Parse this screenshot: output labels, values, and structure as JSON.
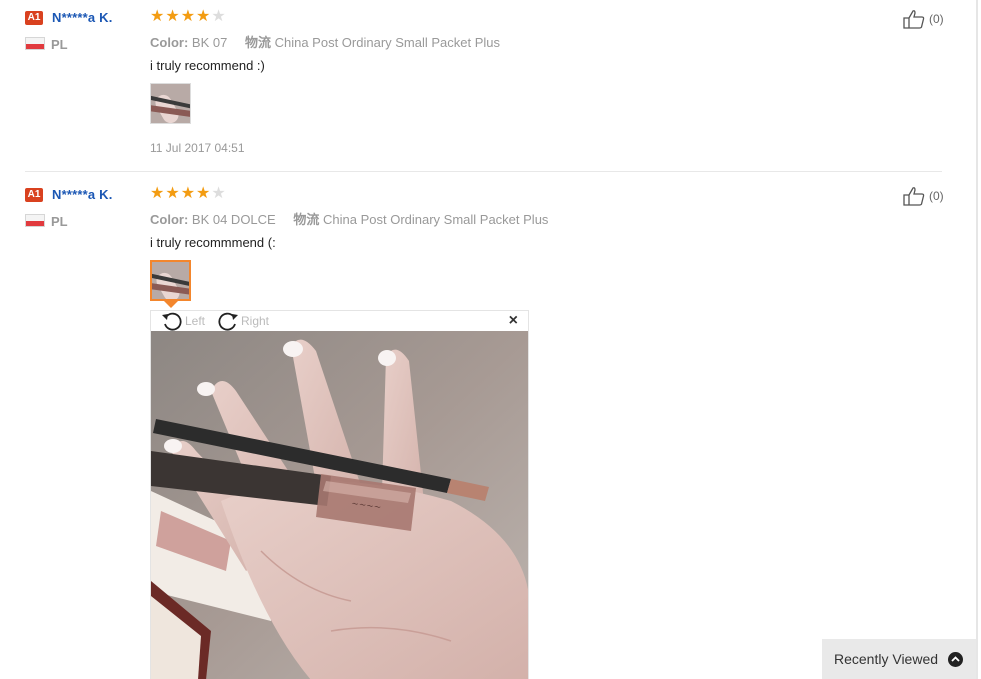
{
  "reviews": [
    {
      "badge": "A1",
      "username": "N*****a K.",
      "country": "PL",
      "rating": 4,
      "color_label": "Color:",
      "color_value": "BK 07",
      "shipping_label": "物流",
      "shipping_value": "China Post Ordinary Small Packet Plus",
      "text": "i truly recommend :)",
      "date": "11 Jul 2017 04:51",
      "helpful_count": "(0)"
    },
    {
      "badge": "A1",
      "username": "N*****a K.",
      "country": "PL",
      "rating": 4,
      "color_label": "Color:",
      "color_value": "BK 04 DOLCE",
      "shipping_label": "物流",
      "shipping_value": "China Post Ordinary Small Packet Plus",
      "text": "i truly recommmend (:",
      "helpful_count": "(0)"
    }
  ],
  "viewer": {
    "rotate_left": "Left",
    "rotate_right": "Right",
    "close": "×"
  },
  "recently_viewed": {
    "label": "Recently Viewed"
  },
  "colors": {
    "username": "#1b57b4",
    "star": "#f39c12",
    "badge": "#d9411f",
    "thumb_active": "#f3862d"
  }
}
